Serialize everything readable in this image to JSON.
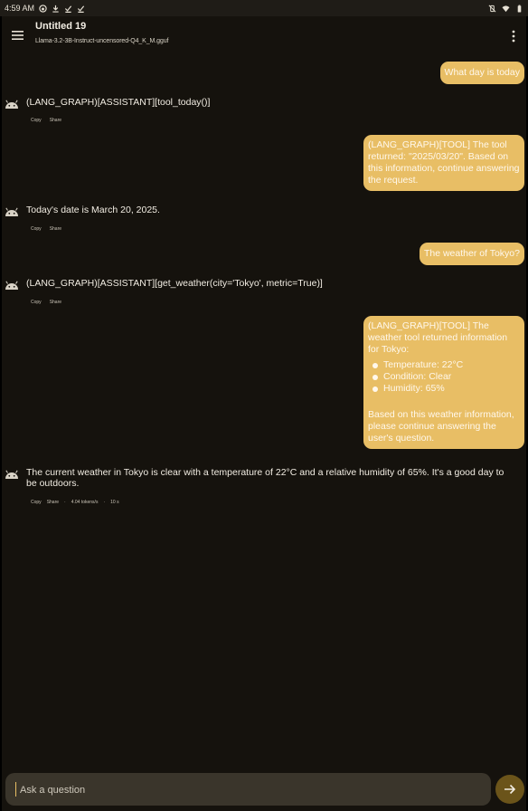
{
  "status_bar": {
    "time": "4:59 AM"
  },
  "app_bar": {
    "title": "Untitled 19",
    "model": "Llama-3.2-3B-Instruct-uncensored-Q4_K_M.gguf"
  },
  "messages": [
    {
      "role": "user",
      "text": "What day is today"
    },
    {
      "role": "assistant",
      "text": "(LANG_GRAPH)[ASSISTANT][tool_today()]"
    },
    {
      "role": "user",
      "text": "(LANG_GRAPH)[TOOL] The tool returned: \"2025/03/20\". Based on this information, continue answering the request."
    },
    {
      "role": "assistant",
      "text": "Today's date is March 20, 2025."
    },
    {
      "role": "user",
      "text": "The weather of Tokyo?"
    },
    {
      "role": "assistant",
      "text": "(LANG_GRAPH)[ASSISTANT][get_weather(city='Tokyo', metric=True)]"
    },
    {
      "role": "user",
      "intro": "(LANG_GRAPH)[TOOL] The weather tool returned information for Tokyo:",
      "bullets": [
        "Temperature: 22°C",
        "Condition: Clear",
        "Humidity: 65%"
      ],
      "outro": "Based on this weather information, please continue answering the user's question."
    },
    {
      "role": "assistant",
      "text": "The current weather in Tokyo is clear with a temperature of 22°C and a relative humidity of 65%. It's a good day to be outdoors.",
      "speed": "4.04 tokens/s",
      "time": "10 s"
    }
  ],
  "actions": {
    "copy": "Copy",
    "share": "Share",
    "separator": "·"
  },
  "composer": {
    "placeholder": "Ask a question"
  },
  "colors": {
    "accent": "#e8be65",
    "background": "#15120d",
    "composer": "#3a352b",
    "send": "#6b541a"
  }
}
